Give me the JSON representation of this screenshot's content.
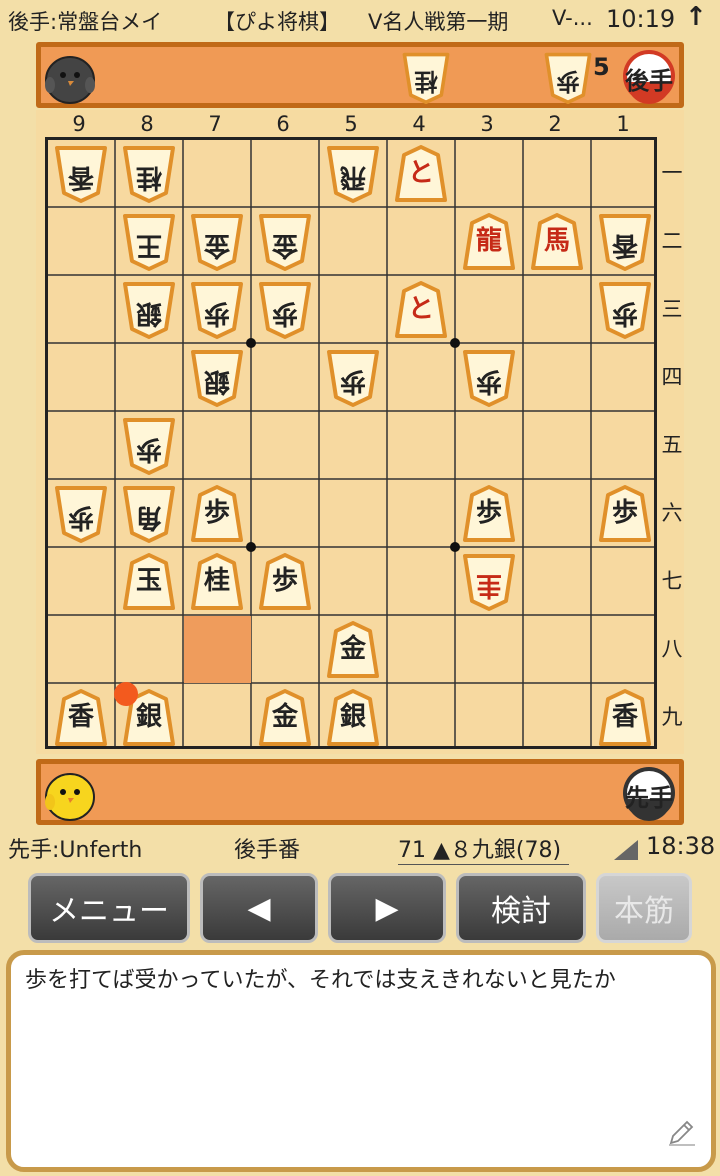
{
  "status_bar": {
    "gote_player": "後手:常盤台メイ",
    "app_name": "【ぴよ将棋】",
    "event": "V名人戦第一期",
    "event_more": "V-...",
    "time": "10:19",
    "arrow": "↑"
  },
  "gote_hand": {
    "pieces": [
      {
        "char": "桂"
      },
      {
        "char": "歩",
        "count": "5"
      }
    ],
    "badge_label": "後手",
    "avatar_icon": "gray-chick-icon"
  },
  "sente_hand": {
    "pieces": [],
    "badge_label": "先手",
    "avatar_icon": "yellow-chick-icon"
  },
  "board": {
    "files": [
      "9",
      "8",
      "7",
      "6",
      "5",
      "4",
      "3",
      "2",
      "1"
    ],
    "ranks": [
      "一",
      "二",
      "三",
      "四",
      "五",
      "六",
      "七",
      "八",
      "九"
    ],
    "highlight_square": "7八",
    "pieces": [
      {
        "file": 9,
        "rank": 1,
        "char": "香",
        "side": "gote",
        "promoted": false
      },
      {
        "file": 8,
        "rank": 1,
        "char": "桂",
        "side": "gote",
        "promoted": false
      },
      {
        "file": 5,
        "rank": 1,
        "char": "飛",
        "side": "gote",
        "promoted": false
      },
      {
        "file": 4,
        "rank": 1,
        "char": "と",
        "side": "sente",
        "promoted": true
      },
      {
        "file": 8,
        "rank": 2,
        "char": "王",
        "side": "gote",
        "promoted": false
      },
      {
        "file": 7,
        "rank": 2,
        "char": "金",
        "side": "gote",
        "promoted": false
      },
      {
        "file": 6,
        "rank": 2,
        "char": "金",
        "side": "gote",
        "promoted": false
      },
      {
        "file": 3,
        "rank": 2,
        "char": "龍",
        "side": "sente",
        "promoted": true
      },
      {
        "file": 2,
        "rank": 2,
        "char": "馬",
        "side": "sente",
        "promoted": true
      },
      {
        "file": 1,
        "rank": 2,
        "char": "香",
        "side": "gote",
        "promoted": false
      },
      {
        "file": 8,
        "rank": 3,
        "char": "銀",
        "side": "gote",
        "promoted": false
      },
      {
        "file": 7,
        "rank": 3,
        "char": "歩",
        "side": "gote",
        "promoted": false
      },
      {
        "file": 6,
        "rank": 3,
        "char": "歩",
        "side": "gote",
        "promoted": false
      },
      {
        "file": 4,
        "rank": 3,
        "char": "と",
        "side": "sente",
        "promoted": true
      },
      {
        "file": 1,
        "rank": 3,
        "char": "歩",
        "side": "gote",
        "promoted": false
      },
      {
        "file": 7,
        "rank": 4,
        "char": "銀",
        "side": "gote",
        "promoted": false
      },
      {
        "file": 5,
        "rank": 4,
        "char": "歩",
        "side": "gote",
        "promoted": false
      },
      {
        "file": 3,
        "rank": 4,
        "char": "歩",
        "side": "gote",
        "promoted": false
      },
      {
        "file": 8,
        "rank": 5,
        "char": "歩",
        "side": "gote",
        "promoted": false
      },
      {
        "file": 9,
        "rank": 6,
        "char": "歩",
        "side": "gote",
        "promoted": false
      },
      {
        "file": 8,
        "rank": 6,
        "char": "角",
        "side": "gote",
        "promoted": false
      },
      {
        "file": 7,
        "rank": 6,
        "char": "歩",
        "side": "sente",
        "promoted": false
      },
      {
        "file": 3,
        "rank": 6,
        "char": "歩",
        "side": "sente",
        "promoted": false
      },
      {
        "file": 1,
        "rank": 6,
        "char": "歩",
        "side": "sente",
        "promoted": false
      },
      {
        "file": 8,
        "rank": 7,
        "char": "玉",
        "side": "sente",
        "promoted": false
      },
      {
        "file": 7,
        "rank": 7,
        "char": "桂",
        "side": "sente",
        "promoted": false
      },
      {
        "file": 6,
        "rank": 7,
        "char": "歩",
        "side": "sente",
        "promoted": false
      },
      {
        "file": 3,
        "rank": 7,
        "char": "圭",
        "side": "gote",
        "promoted": true
      },
      {
        "file": 5,
        "rank": 8,
        "char": "金",
        "side": "sente",
        "promoted": false
      },
      {
        "file": 9,
        "rank": 9,
        "char": "香",
        "side": "sente",
        "promoted": false
      },
      {
        "file": 8,
        "rank": 9,
        "char": "銀",
        "side": "sente",
        "promoted": false
      },
      {
        "file": 6,
        "rank": 9,
        "char": "金",
        "side": "sente",
        "promoted": false
      },
      {
        "file": 5,
        "rank": 9,
        "char": "銀",
        "side": "sente",
        "promoted": false
      },
      {
        "file": 1,
        "rank": 9,
        "char": "香",
        "side": "sente",
        "promoted": false
      }
    ]
  },
  "info_bar": {
    "sente_player": "先手:Unferth",
    "turn": "後手番",
    "move": "71 ▲８九銀(78)",
    "clock": "18:38"
  },
  "buttons": {
    "menu": "メニュー",
    "prev": "◀",
    "next": "▶",
    "analyze": "検討",
    "mainline": "本筋"
  },
  "comment": {
    "text": "歩を打てば受かっていたが、それでは支えきれないと見たか",
    "edit_icon": "pencil-icon"
  },
  "colors": {
    "piece_face": "#fff6d8",
    "piece_edge": "#e0902a",
    "promoted": "#c62a17",
    "board": "#f7d9a0",
    "hand": "#f09a55"
  }
}
